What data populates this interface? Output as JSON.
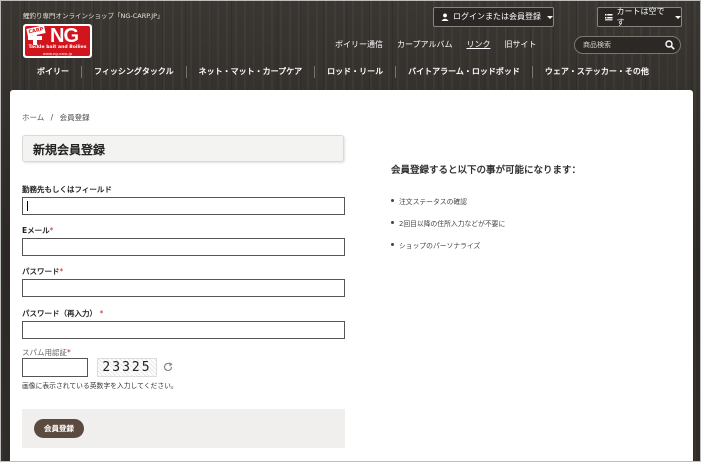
{
  "header": {
    "tagline": "鯉釣り専門オンラインショップ「NG-CARP.JP」",
    "logo": {
      "carp": "CARP",
      "brand": "NG",
      "subtitle": "Tackle bait and Boilies",
      "url": "www.ng-carp.jp"
    },
    "login_label": "ログインまたは会員登録",
    "cart_label": "カートは空です",
    "top_links": [
      "ボイリー通信",
      "カープアルバム",
      "リンク",
      "旧サイト"
    ],
    "search_placeholder": "商品検索"
  },
  "nav": {
    "items": [
      "ボイリー",
      "フィッシングタックル",
      "ネット・マット・カープケア",
      "ロッド・リール",
      "バイトアラーム・ロッドポッド",
      "ウェア・ステッカー・その他"
    ]
  },
  "breadcrumb": {
    "home": "ホーム",
    "separator": "/",
    "current": "会員登録"
  },
  "form": {
    "title": "新規会員登録",
    "fields": [
      {
        "label": "勤務先もしくはフィールド",
        "required": false,
        "value": ""
      },
      {
        "label": "Eメール",
        "required": true,
        "value": ""
      },
      {
        "label": "パスワード",
        "required": true,
        "value": ""
      },
      {
        "label": "パスワード（再入力）",
        "required": true,
        "value": ""
      }
    ],
    "required_mark": "*",
    "spam_label": "スパム用認証",
    "captcha_text": "23325",
    "captcha_hint": "画像に表示されている英数字を入力してください。",
    "submit_label": "会員登録"
  },
  "benefits": {
    "title": "会員登録すると以下の事が可能になります：",
    "items": [
      "注文ステータスの確認",
      "2回目以降の住所入力などが不要に",
      "ショップのパーソナライズ"
    ]
  }
}
